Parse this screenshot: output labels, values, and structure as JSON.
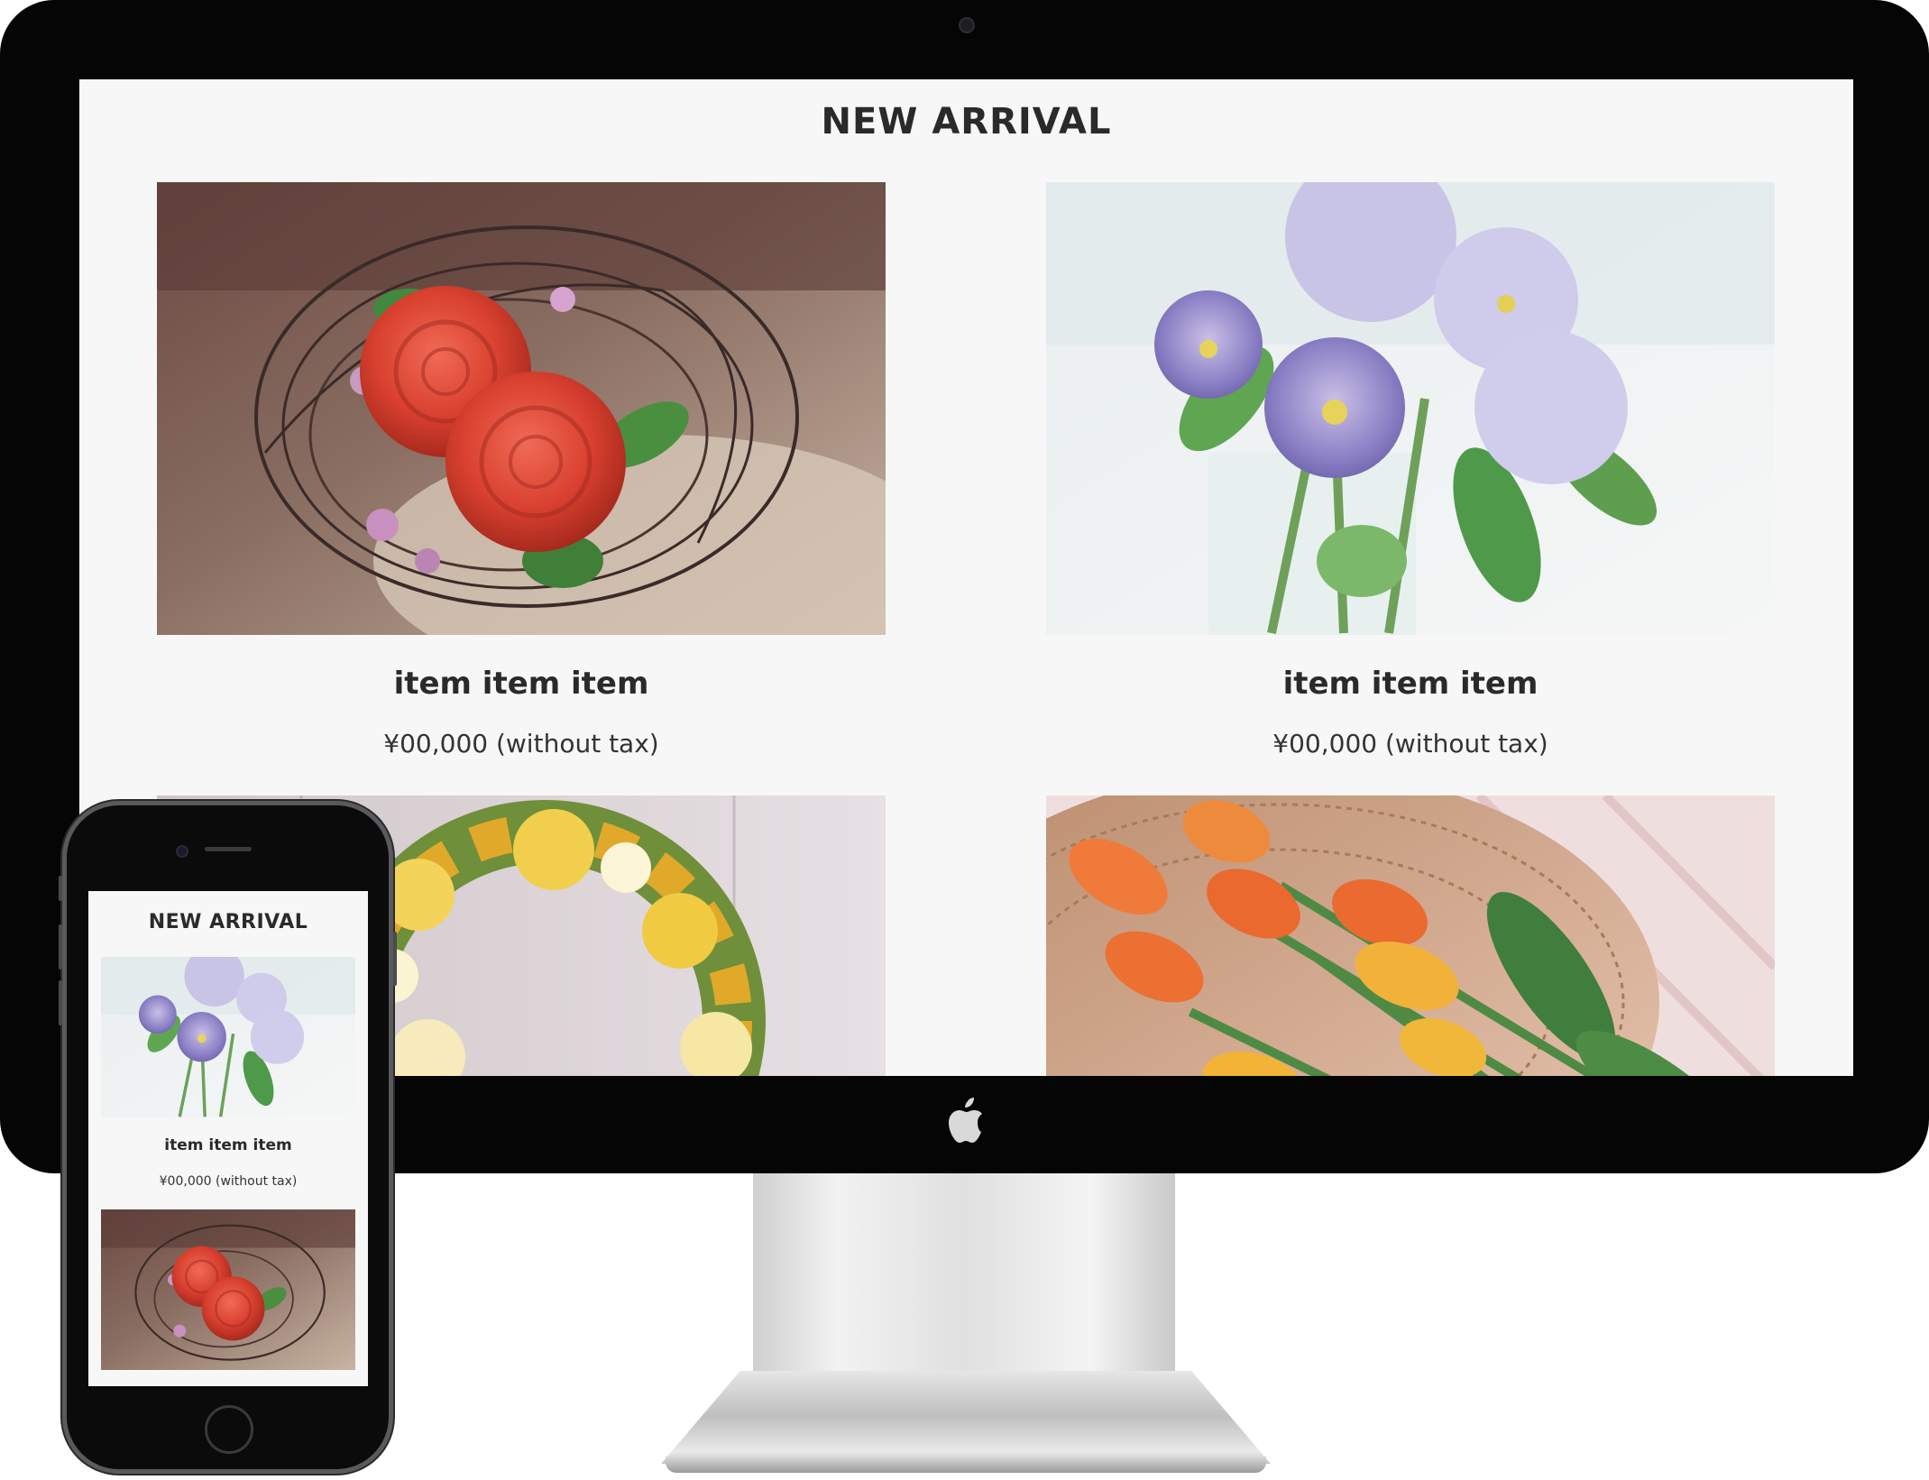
{
  "desktop": {
    "title": "NEW ARRIVAL",
    "items": [
      {
        "name": "item item item",
        "price": "¥00,000 (without tax)",
        "image": "red-roses-basket-photo"
      },
      {
        "name": "item item item",
        "price": "¥00,000 (without tax)",
        "image": "purple-pansies-vase-photo"
      },
      {
        "image": "yellow-flower-wreath-photo"
      },
      {
        "image": "orange-tulips-basket-photo"
      }
    ]
  },
  "mobile": {
    "title": "NEW ARRIVAL",
    "items": [
      {
        "name": "item item item",
        "price": "¥00,000 (without tax)",
        "image": "purple-pansies-vase-photo"
      },
      {
        "image": "red-roses-basket-photo"
      }
    ]
  },
  "colors": {
    "page_background": "#f7f7f7",
    "bezel": "#050505",
    "title_text": "#2a2a2a"
  }
}
